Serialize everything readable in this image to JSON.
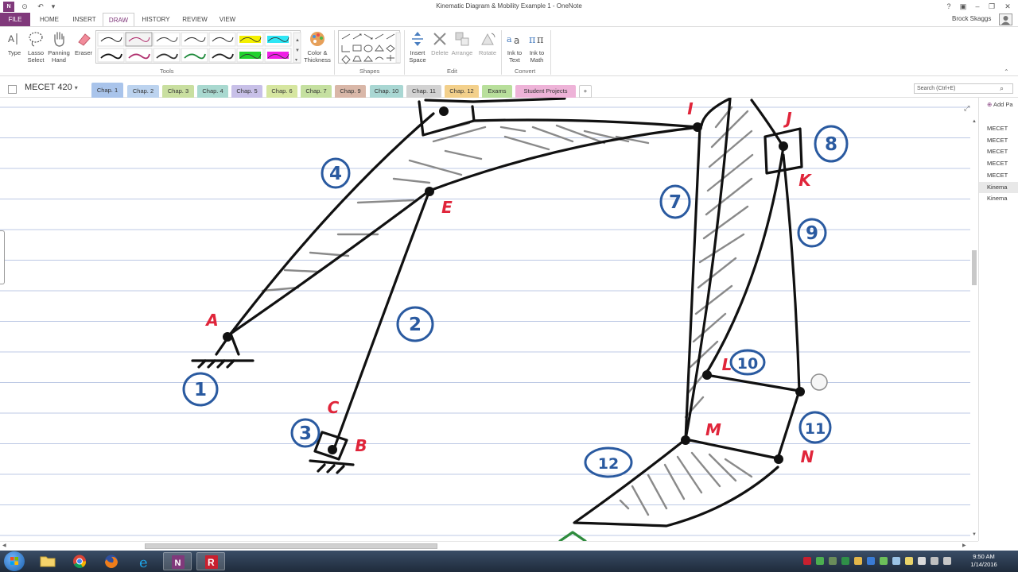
{
  "window": {
    "title": "Kinematic Diagram & Mobility Example 1 - OneNote",
    "user": "Brock Skaggs"
  },
  "ribbon_tabs": [
    "FILE",
    "HOME",
    "INSERT",
    "DRAW",
    "HISTORY",
    "REVIEW",
    "VIEW"
  ],
  "ribbon": {
    "tools": {
      "type": "Type",
      "lasso": "Lasso Select",
      "pan": "Panning Hand",
      "eraser": "Eraser",
      "color_thickness": "Color & Thickness",
      "label": "Tools"
    },
    "shapes_label": "Shapes",
    "edit": {
      "insert_space": "Insert Space",
      "delete": "Delete",
      "arrange": "Arrange",
      "rotate": "Rotate",
      "label": "Edit"
    },
    "convert": {
      "ink_to_text": "Ink to Text",
      "ink_to_math": "Ink to Math",
      "label": "Convert"
    }
  },
  "notebook": {
    "name": "MECET 420",
    "sections": [
      {
        "label": "Chap. 1",
        "color": "#a9c4eb"
      },
      {
        "label": "Chap. 2",
        "color": "#bcd3ef"
      },
      {
        "label": "Chap. 3",
        "color": "#c9dfa0"
      },
      {
        "label": "Chap. 4",
        "color": "#a9d9d0"
      },
      {
        "label": "Chap. 5",
        "color": "#c8c0e8"
      },
      {
        "label": "Chap. 6",
        "color": "#d6e6a0"
      },
      {
        "label": "Chap. 7",
        "color": "#c5e0a0"
      },
      {
        "label": "Chap. 9",
        "color": "#d9b7a8"
      },
      {
        "label": "Chap. 10",
        "color": "#a9d7d3"
      },
      {
        "label": "Chap. 11",
        "color": "#d2d2d2"
      },
      {
        "label": "Chap. 12",
        "color": "#f3d08b"
      },
      {
        "label": "Exams",
        "color": "#b8df9b"
      },
      {
        "label": "Student Projects",
        "color": "#eeb3d8"
      },
      {
        "label": "+",
        "color": "#ffffff"
      }
    ],
    "search_placeholder": "Search (Ctrl+E)"
  },
  "pages": {
    "add_label": "Add Pa",
    "items": [
      "MECET",
      "MECET",
      "MECET",
      "MECET",
      "MECET",
      "Kinema",
      "Kinema"
    ],
    "selected_index": 5
  },
  "sketch": {
    "joint_labels": [
      "I",
      "J",
      "K",
      "E",
      "A",
      "C",
      "B",
      "L",
      "M",
      "N"
    ],
    "link_numbers": [
      "1",
      "2",
      "3",
      "4",
      "7",
      "8",
      "9",
      "10",
      "11",
      "12"
    ],
    "joint_color": "#e0253a",
    "link_color": "#2a5aa0",
    "ink_color": "#111111",
    "hatch_color": "#8a8a8a"
  },
  "taskbar": {
    "time": "9:50 AM",
    "date": "1/14/2016"
  },
  "colors": {
    "accent": "#80397b"
  }
}
